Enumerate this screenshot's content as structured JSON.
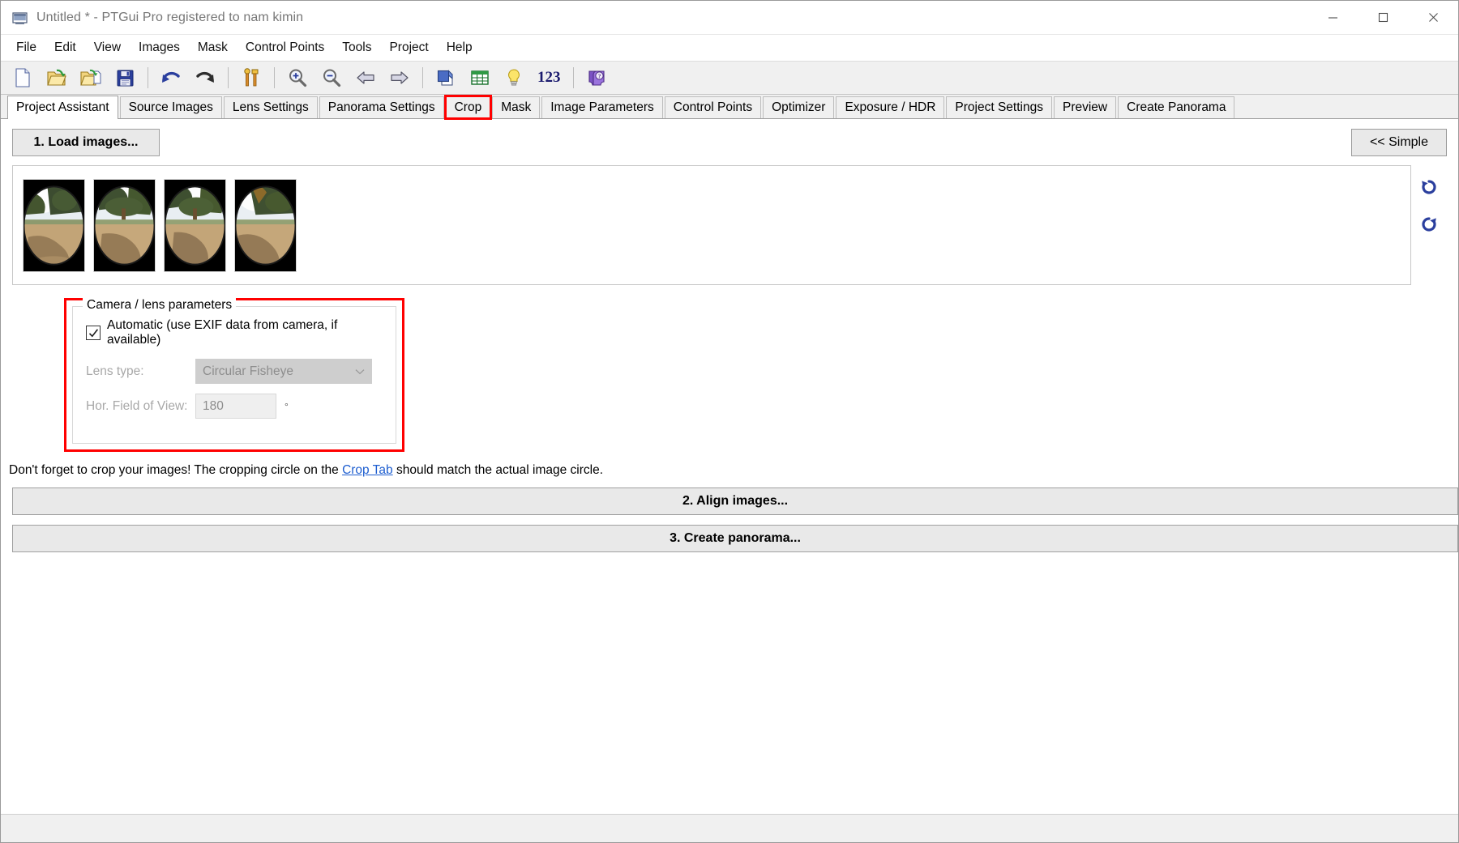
{
  "window": {
    "title": "Untitled * - PTGui Pro registered to nam kimin",
    "icon": "app-window-icon",
    "controls": {
      "minimize": "–",
      "maximize": "☐",
      "close": "✕"
    }
  },
  "menubar": {
    "items": [
      {
        "label": "File"
      },
      {
        "label": "Edit"
      },
      {
        "label": "View"
      },
      {
        "label": "Images"
      },
      {
        "label": "Mask"
      },
      {
        "label": "Control Points"
      },
      {
        "label": "Tools"
      },
      {
        "label": "Project"
      },
      {
        "label": "Help"
      }
    ]
  },
  "toolbar": {
    "buttons": [
      {
        "name": "new-project-icon",
        "title": "New Project"
      },
      {
        "name": "open-project-icon",
        "title": "Open Project"
      },
      {
        "name": "open-template-icon",
        "title": "Open Template"
      },
      {
        "name": "save-project-icon",
        "title": "Save Project"
      },
      {
        "name": "undo-icon",
        "title": "Undo"
      },
      {
        "name": "redo-icon",
        "title": "Redo"
      },
      {
        "name": "align-tools-icon",
        "title": "Align Images"
      },
      {
        "name": "zoom-in-icon",
        "title": "Zoom In"
      },
      {
        "name": "zoom-out-icon",
        "title": "Zoom Out"
      },
      {
        "name": "previous-icon",
        "title": "Previous"
      },
      {
        "name": "next-icon",
        "title": "Next"
      },
      {
        "name": "layers-icon",
        "title": "Layers"
      },
      {
        "name": "table-icon",
        "title": "Table"
      },
      {
        "name": "lightbulb-icon",
        "title": "Hints"
      },
      {
        "name": "numbers-icon",
        "title": "123"
      },
      {
        "name": "help-book-icon",
        "title": "Help"
      }
    ],
    "numbers_label": "123"
  },
  "tabs": {
    "items": [
      {
        "label": "Project Assistant",
        "active": true,
        "highlight": false
      },
      {
        "label": "Source Images",
        "active": false,
        "highlight": false
      },
      {
        "label": "Lens Settings",
        "active": false,
        "highlight": false
      },
      {
        "label": "Panorama Settings",
        "active": false,
        "highlight": false
      },
      {
        "label": "Crop",
        "active": false,
        "highlight": true
      },
      {
        "label": "Mask",
        "active": false,
        "highlight": false
      },
      {
        "label": "Image Parameters",
        "active": false,
        "highlight": false
      },
      {
        "label": "Control Points",
        "active": false,
        "highlight": false
      },
      {
        "label": "Optimizer",
        "active": false,
        "highlight": false
      },
      {
        "label": "Exposure / HDR",
        "active": false,
        "highlight": false
      },
      {
        "label": "Project Settings",
        "active": false,
        "highlight": false
      },
      {
        "label": "Preview",
        "active": false,
        "highlight": false
      },
      {
        "label": "Create Panorama",
        "active": false,
        "highlight": false
      }
    ],
    "highlight_color": "#ff0000"
  },
  "assistant": {
    "load_images_label": "1. Load images...",
    "align_images_label": "2. Align images...",
    "create_panorama_label": "3. Create panorama...",
    "simple_label": "<< Simple",
    "hint": {
      "before": "Don't forget to crop your images! The cropping circle on the ",
      "link": "Crop Tab",
      "after": " should match the actual image circle."
    }
  },
  "thumbnails": {
    "count": 4,
    "items": [
      {
        "name": "thumbnail-image-1",
        "variant": 1
      },
      {
        "name": "thumbnail-image-2",
        "variant": 2
      },
      {
        "name": "thumbnail-image-3",
        "variant": 3
      },
      {
        "name": "thumbnail-image-4",
        "variant": 4
      }
    ],
    "rotate_left": "rotate-left-icon",
    "rotate_right": "rotate-right-icon"
  },
  "camera_lens": {
    "group_title": "Camera / lens parameters",
    "automatic": {
      "label": "Automatic (use EXIF data from camera, if available)",
      "checked": true
    },
    "lens_type": {
      "label": "Lens type:",
      "value": "Circular Fisheye",
      "enabled": false
    },
    "hfov": {
      "label": "Hor. Field of View:",
      "value": "180",
      "unit": "°",
      "enabled": false
    },
    "highlight_color": "#ff0000"
  },
  "statusbar": {
    "text": ""
  }
}
